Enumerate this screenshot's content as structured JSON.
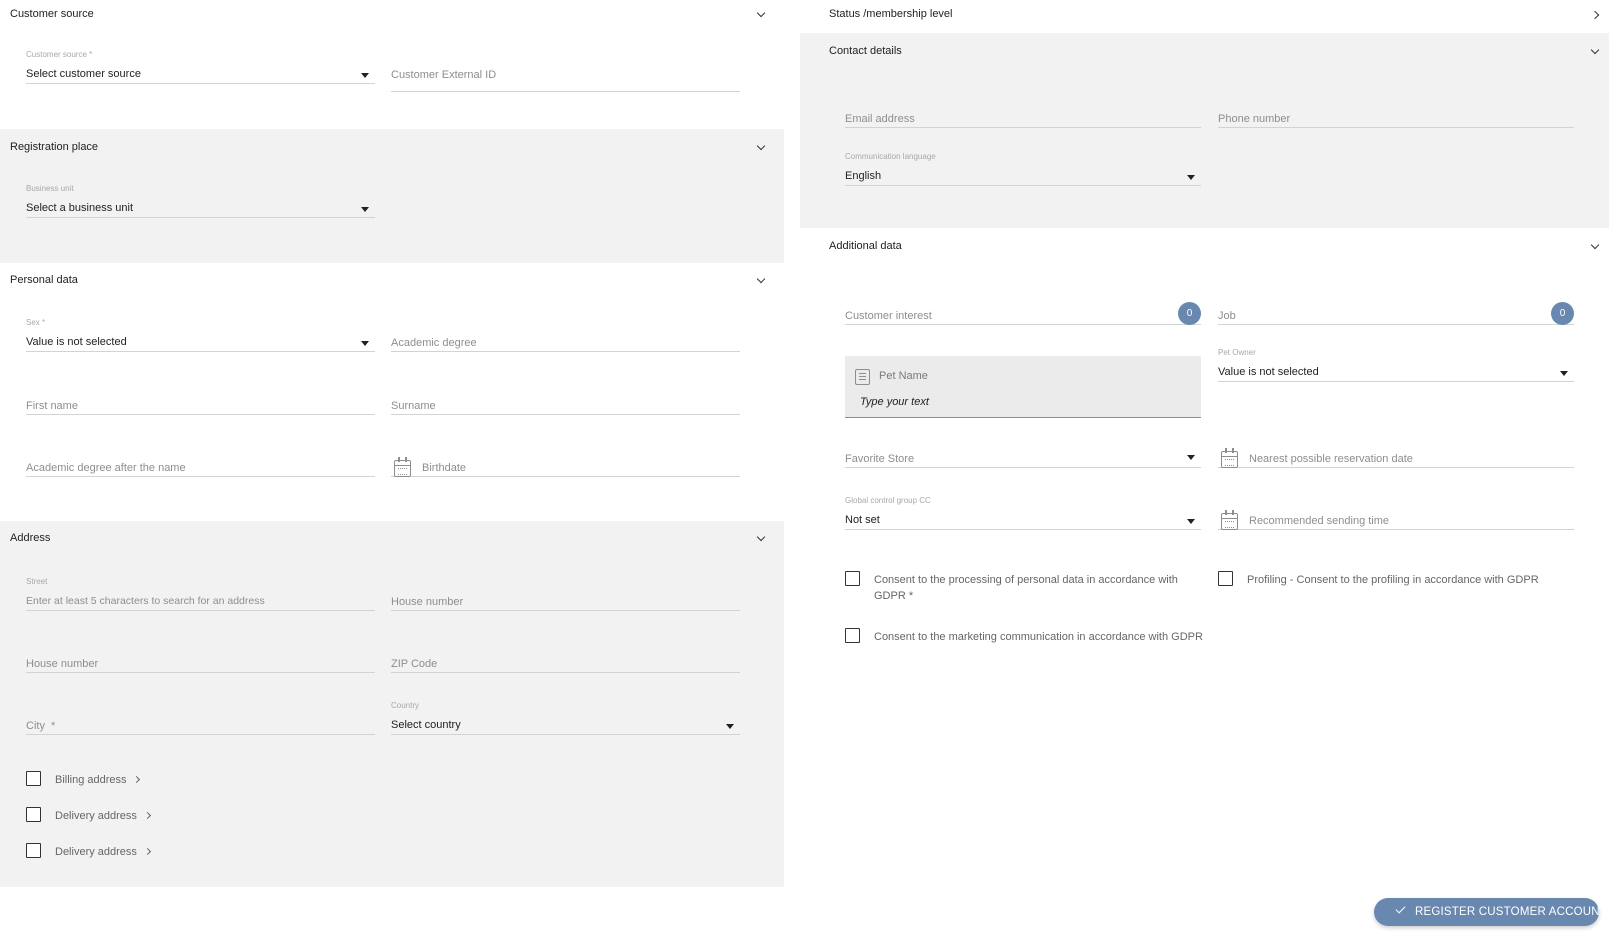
{
  "left": {
    "customer_source": {
      "title": "Customer source",
      "source_label": "Customer source *",
      "source_value": "Select customer source",
      "external_id_placeholder": "Customer External ID"
    },
    "registration_place": {
      "title": "Registration place",
      "business_unit_label": "Business unit",
      "business_unit_value": "Select a business unit"
    },
    "personal_data": {
      "title": "Personal data",
      "sex_label": "Sex *",
      "sex_value": "Value is not selected",
      "academic_degree_placeholder": "Academic degree",
      "first_name_placeholder": "First name",
      "surname_placeholder": "Surname",
      "degree_after_placeholder": "Academic degree after the name",
      "birthdate_placeholder": "Birthdate"
    },
    "address": {
      "title": "Address",
      "street_label": "Street",
      "street_placeholder": "Enter at least 5 characters to search for an address",
      "house_number_placeholder_1": "House number",
      "house_number_placeholder_2": "House number",
      "zip_placeholder": "ZIP Code",
      "city_placeholder": "City  *",
      "country_label": "Country",
      "country_value": "Select country",
      "billing_label": "Billing address",
      "delivery_label_1": "Delivery address",
      "delivery_label_2": "Delivery address"
    }
  },
  "right": {
    "status": {
      "title": "Status /membership level"
    },
    "contact": {
      "title": "Contact details",
      "email_placeholder": "Email address",
      "phone_placeholder": "Phone number",
      "language_label": "Communication language",
      "language_value": "English"
    },
    "additional": {
      "title": "Additional data",
      "customer_interest_placeholder": "Customer interest",
      "customer_interest_count": "0",
      "job_placeholder": "Job",
      "job_count": "0",
      "pet_name_label": "Pet Name",
      "pet_name_placeholder": "Type your text",
      "pet_owner_label": "Pet Owner",
      "pet_owner_value": "Value is not selected",
      "favorite_store_placeholder": "Favorite Store",
      "reservation_placeholder": "Nearest possible reservation date",
      "control_group_label": "Global control group CC",
      "control_group_value": "Not set",
      "sending_time_placeholder": "Recommended sending time",
      "consent_personal": "Consent to the processing of personal data in accordance with GDPR *",
      "consent_profiling": "Profiling - Consent to the profiling in accordance with GDPR",
      "consent_marketing": "Consent to the marketing communication in accordance with GDPR"
    }
  },
  "actions": {
    "register_label": "REGISTER CUSTOMER ACCOUNT"
  },
  "colors": {
    "accent": "#6888b0",
    "section_grey": "#f2f2f2"
  },
  "icons": {
    "section_toggle": "chevron-down-icon",
    "status_toggle": "chevron-right-icon",
    "date": "calendar-icon",
    "note": "note-icon",
    "submit": "check-icon"
  }
}
